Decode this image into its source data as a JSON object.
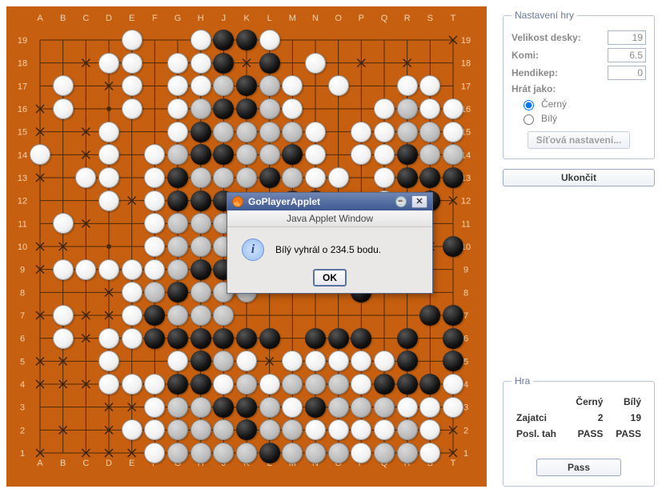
{
  "board": {
    "size": 19,
    "cols": [
      "A",
      "B",
      "C",
      "D",
      "E",
      "F",
      "G",
      "H",
      "J",
      "K",
      "L",
      "M",
      "N",
      "O",
      "P",
      "Q",
      "R",
      "S",
      "T"
    ],
    "rows": [
      "....W..WBBW.......a",
      "..aWW.WWBaB.W.a.a..",
      ".W.aW.WWbBbW.W..WW.",
      "aW..W.WbBBbW...WbWW",
      "a.aW..WBbbbbW.WWbbW",
      "W.aW.WbBBbbBW.WWBbb",
      "a.WW.WBbbbBbWW.WBBB",
      "...WaWBBB!?BB??W?B?",
      ".Wa..Wbbb...........",
      "aa...Wbbb..?B?????B",
      "aWWWWWbBBB.B.B.....",
      "...aWbBbbb....B....",
      "aWaaWBbbb........BB",
      ".WaWWBBBBBB.BBB.B.B",
      "aa.W..WBbW?WWWWWB.B",
      "aaaWWWBBWbWbbbWBBBW",
      "...aaWbbBBbWBbbbWWW",
      ".a.aWWbbbBbbWWWWbWa",
      "a.aaaWbbbbBbbbWbbWa"
    ],
    "legend": {
      "W": "white-stone",
      "B": "black-stone",
      "b": "black-stone-dead-or-gray",
      "a": "territory-x-mark",
      "?": "territory-x-mark",
      "!": "territory-x-mark",
      ".": "empty"
    }
  },
  "settings": {
    "title": "Nastavení hry",
    "board_size_label": "Velikost desky:",
    "board_size": "19",
    "komi_label": "Komi:",
    "komi": "6.5",
    "handicap_label": "Hendikep:",
    "handicap": "0",
    "play_as_label": "Hrát jako:",
    "black_label": "Černý",
    "white_label": "Bílý",
    "selected_color": "black",
    "network_btn": "Síťová nastavení...",
    "quit_btn": "Ukončit"
  },
  "game": {
    "title": "Hra",
    "col_black": "Černý",
    "col_white": "Bílý",
    "row_prisoners": "Zajatci",
    "prisoners_black": "2",
    "prisoners_white": "19",
    "row_lastmove": "Posl. tah",
    "last_black": "PASS",
    "last_white": "PASS",
    "pass_btn": "Pass"
  },
  "dialog": {
    "title": "GoPlayerApplet",
    "subtitle": "Java Applet Window",
    "message": "Bílý vyhrál o 234.5 bodu.",
    "ok": "OK",
    "info_glyph": "i"
  }
}
